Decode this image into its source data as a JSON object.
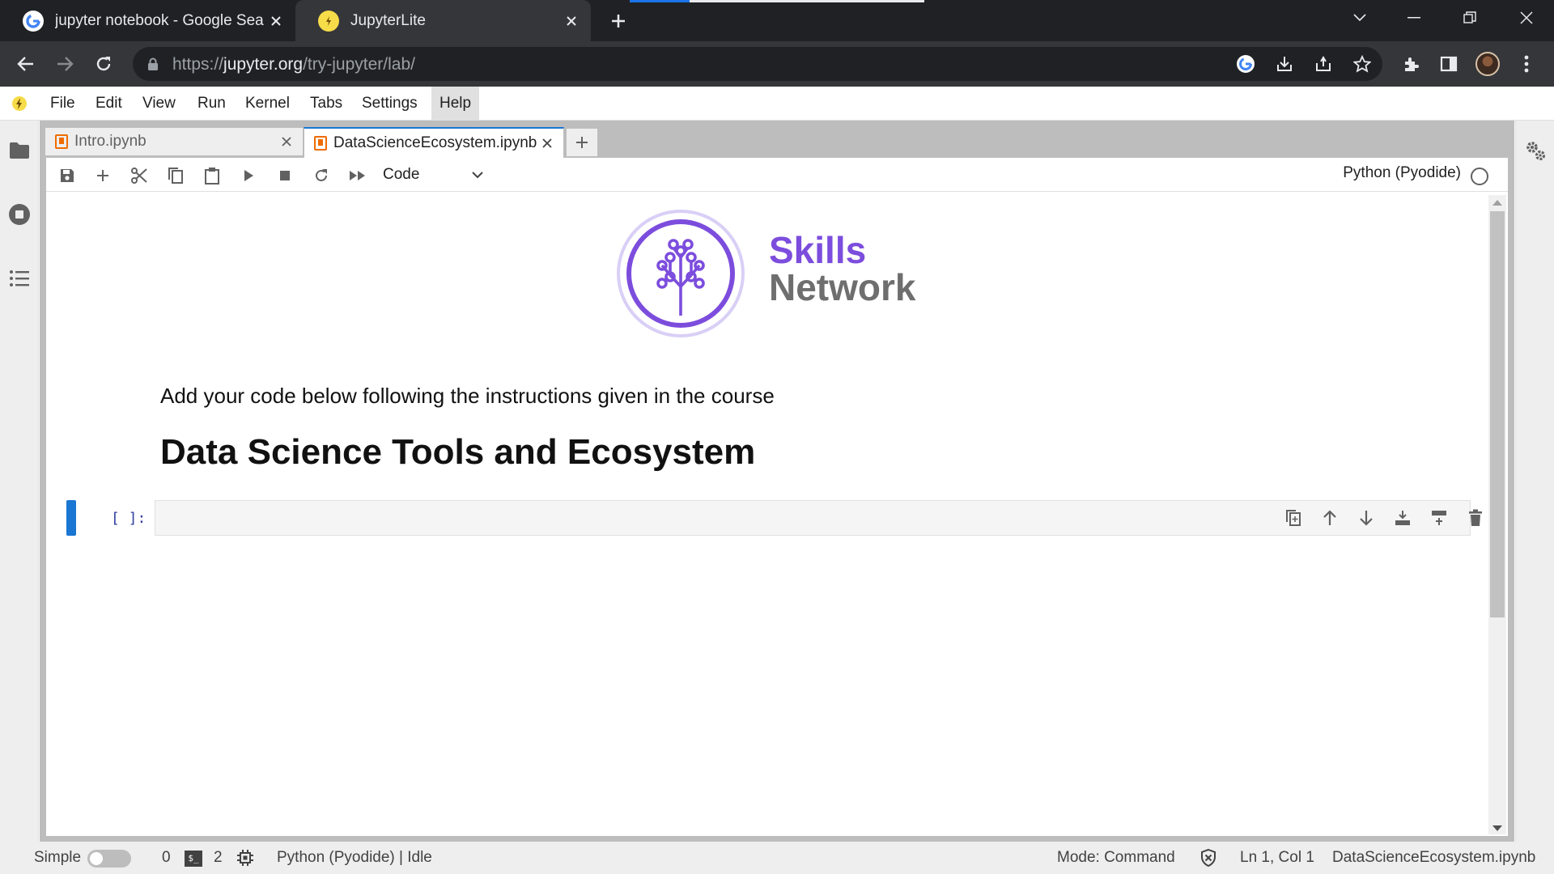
{
  "browser": {
    "tabs": [
      {
        "title": "jupyter notebook - Google Search",
        "icon": "google-icon"
      },
      {
        "title": "JupyterLite",
        "icon": "jupyterlite-icon"
      }
    ],
    "url_scheme": "https://",
    "url_host": "jupyter.org",
    "url_path": "/try-jupyter/lab/"
  },
  "menubar": {
    "items": [
      "File",
      "Edit",
      "View",
      "Run",
      "Kernel",
      "Tabs",
      "Settings",
      "Help"
    ],
    "active": "Help"
  },
  "dock": {
    "tabs": [
      {
        "label": "Intro.ipynb",
        "current": false
      },
      {
        "label": "DataScienceEcosystem.ipynb",
        "current": true
      }
    ]
  },
  "toolbar": {
    "cell_type": "Code",
    "kernel_name": "Python (Pyodide)"
  },
  "notebook": {
    "brand_line1": "Skills",
    "brand_line2": "Network",
    "instruction_text": "Add your code below following the instructions given in the course",
    "heading": "Data Science Tools and Ecosystem",
    "prompt": "[ ]:",
    "code": ""
  },
  "statusbar": {
    "mode_label": "Simple",
    "kernels_count": "0",
    "terminals_count": "2",
    "kernel_status": "Python (Pyodide) | Idle",
    "mode": "Mode: Command",
    "cursor": "Ln 1, Col 1",
    "filename": "DataScienceEcosystem.ipynb"
  },
  "colors": {
    "accent": "#1976d2",
    "brand_purple": "#7c4ddd",
    "chrome_dark": "#202124"
  }
}
